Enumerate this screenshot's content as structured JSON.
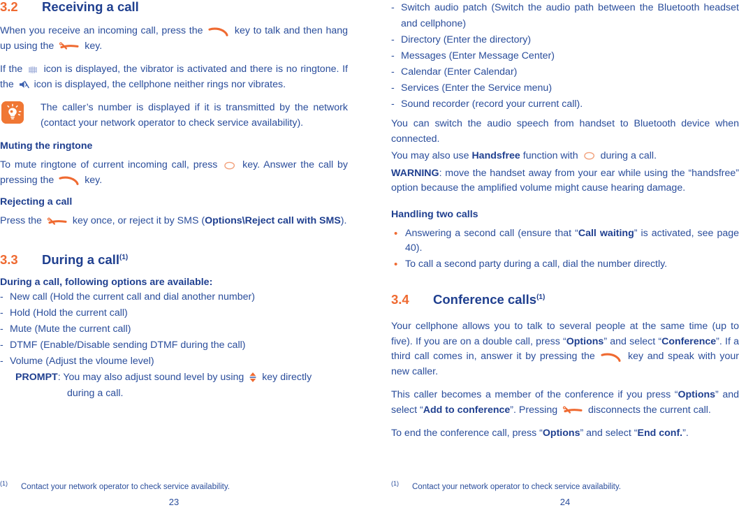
{
  "document": {
    "accent_orange": "#ef6a31",
    "heading_blue": "#1f3f8f",
    "body_blue": "#2a4d9b"
  },
  "left_page": {
    "page_number": "23",
    "footnote": {
      "marker": "(1)",
      "text": "Contact your network operator to check service availability."
    },
    "section_32": {
      "number": "3.2",
      "title": "Receiving a call",
      "para1_a": "When you receive an incoming call, press the",
      "para1_b": "key to talk and then hang up using the",
      "para1_c": "key.",
      "para2_a": "If the",
      "para2_b": "icon is displayed, the vibrator is activated and there is no ringtone. If the",
      "para2_c": "icon is displayed, the cellphone neither rings nor vibrates.",
      "tip": "The caller’s number is displayed if it is transmitted by the network (contact your network operator to check service availability).",
      "mute_head": "Muting the ringtone",
      "mute_a": "To mute ringtone of current incoming call, press",
      "mute_b": "key. Answer the call by pressing the",
      "mute_c": "key.",
      "reject_head": "Rejecting a call",
      "reject_a": "Press the",
      "reject_b": "key once, or reject it by SMS (",
      "reject_bold": "Options\\Reject call with SMS",
      "reject_c": ")."
    },
    "section_33": {
      "number": "3.3",
      "title": "During a call",
      "footnote_marker": "(1)",
      "intro": "During a call, following options are available:",
      "options": [
        "New call (Hold the current call and dial another number)",
        "Hold (Hold the current call)",
        "Mute (Mute the current call)",
        "DTMF (Enable/Disable sending DTMF during the call)",
        "Volume (Adjust the vloume level)"
      ],
      "prompt_label": "PROMPT",
      "prompt_a": ": You may also adjust sound level by using",
      "prompt_b": "key directly",
      "prompt_line2": "during a call."
    }
  },
  "right_page": {
    "page_number": "24",
    "footnote": {
      "marker": "(1)",
      "text": "Contact your network operator to check service availability."
    },
    "continued_options": [
      "Switch audio patch (Switch the audio path between the Bluetooth headset and cellphone)",
      "Directory (Enter the directory)",
      "Messages (Enter Message Center)",
      "Calendar (Enter Calendar)",
      "Services (Enter the Service menu)",
      "Sound recorder (record your current call)."
    ],
    "bt_note": "You can switch the audio speech from handset to Bluetooth device when connected.",
    "handsfree_a": "You may also use",
    "handsfree_bold": "Handsfree",
    "handsfree_b": "function with",
    "handsfree_c": "during a call.",
    "warning_label": "WARNING",
    "warning_text": ": move the handset away from your ear while using the “handsfree” option because the amplified volume might cause hearing damage.",
    "two_calls_head": "Handling two calls",
    "two_calls": [
      {
        "pre": "Answering a second call (ensure that “",
        "bold": "Call waiting",
        "post": "” is activated, see page 40)."
      },
      {
        "pre": "To call a second party during a call, dial the number directly.",
        "bold": "",
        "post": ""
      }
    ],
    "section_34": {
      "number": "3.4",
      "title": "Conference calls",
      "footnote_marker": "(1)",
      "para1_a": "Your cellphone allows you to talk to several people at the same time (up to five). If you are on a double call, press “",
      "para1_bold1": "Options",
      "para1_b": "” and select “",
      "para1_bold2": "Conference",
      "para1_c": "”. If a third call comes in, answer it by pressing the",
      "para1_d": "key and speak with your new caller.",
      "para2_a": "This caller becomes a member of the conference if you press “",
      "para2_bold1": "Options",
      "para2_b": "” and select “",
      "para2_bold2": "Add to conference",
      "para2_c": "”. Pressing",
      "para2_d": "disconnects the current call.",
      "para3_a": "To end the conference call, press “",
      "para3_bold1": "Options",
      "para3_b": "” and select “",
      "para3_bold2": "End conf.",
      "para3_c": "”."
    }
  },
  "icons": {
    "send_key": "send-call-key-icon",
    "end_key": "end-call-key-icon",
    "vibrate": "vibrate-icon",
    "silent": "silent-ringer-icon",
    "soft_key": "soft-key-icon",
    "up_down": "up-down-navigation-key-icon",
    "tip": "tip-lightbulb-icon"
  }
}
